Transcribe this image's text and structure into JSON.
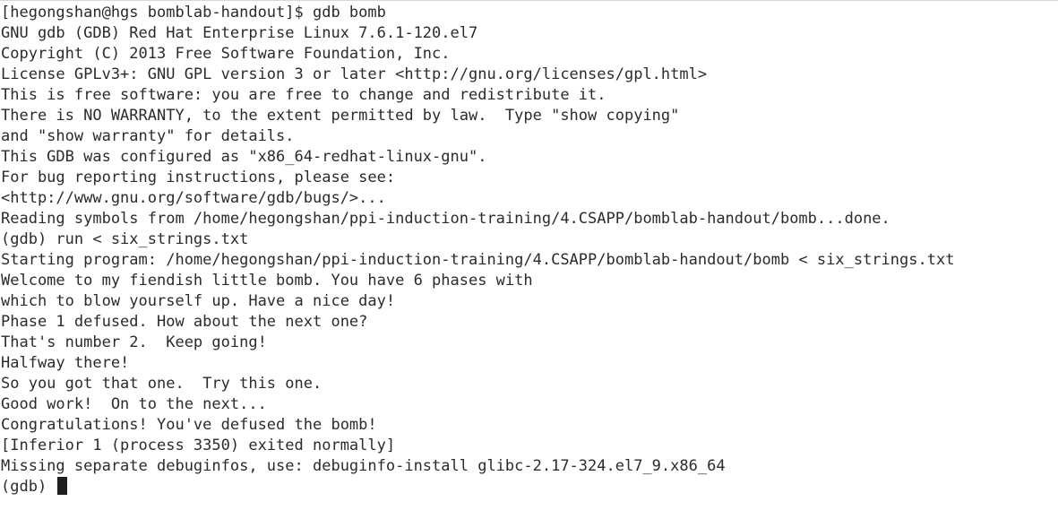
{
  "terminal": {
    "lines": [
      "[hegongshan@hgs bomblab-handout]$ gdb bomb",
      "GNU gdb (GDB) Red Hat Enterprise Linux 7.6.1-120.el7",
      "Copyright (C) 2013 Free Software Foundation, Inc.",
      "License GPLv3+: GNU GPL version 3 or later <http://gnu.org/licenses/gpl.html>",
      "This is free software: you are free to change and redistribute it.",
      "There is NO WARRANTY, to the extent permitted by law.  Type \"show copying\"",
      "and \"show warranty\" for details.",
      "This GDB was configured as \"x86_64-redhat-linux-gnu\".",
      "For bug reporting instructions, please see:",
      "<http://www.gnu.org/software/gdb/bugs/>...",
      "Reading symbols from /home/hegongshan/ppi-induction-training/4.CSAPP/bomblab-handout/bomb...done.",
      "(gdb) run < six_strings.txt",
      "Starting program: /home/hegongshan/ppi-induction-training/4.CSAPP/bomblab-handout/bomb < six_strings.txt",
      "Welcome to my fiendish little bomb. You have 6 phases with",
      "which to blow yourself up. Have a nice day!",
      "Phase 1 defused. How about the next one?",
      "That's number 2.  Keep going!",
      "Halfway there!",
      "So you got that one.  Try this one.",
      "Good work!  On to the next...",
      "Congratulations! You've defused the bomb!",
      "[Inferior 1 (process 3350) exited normally]",
      "Missing separate debuginfos, use: debuginfo-install glibc-2.17-324.el7_9.x86_64"
    ],
    "prompt": "(gdb) "
  }
}
